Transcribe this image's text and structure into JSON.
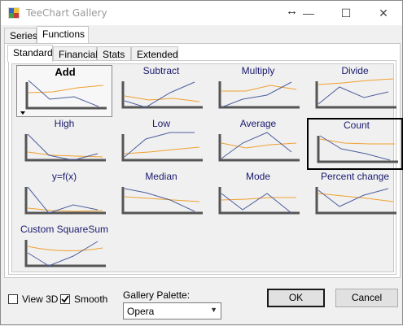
{
  "window": {
    "title": "TeeChart Gallery"
  },
  "titlebar": {
    "move_glyph": "↔",
    "minimize": "—",
    "maximize": "☐",
    "close": "✕"
  },
  "top_tabs": [
    "Series",
    "Functions"
  ],
  "sub_tabs": [
    "Standard",
    "Financial",
    "Stats",
    "Extended"
  ],
  "gallery": {
    "items": [
      {
        "label": "Add"
      },
      {
        "label": "Subtract"
      },
      {
        "label": "Multiply"
      },
      {
        "label": "Divide"
      },
      {
        "label": "High"
      },
      {
        "label": "Low"
      },
      {
        "label": "Average"
      },
      {
        "label": "Count"
      },
      {
        "label": "y=f(x)"
      },
      {
        "label": "Median"
      },
      {
        "label": "Mode"
      },
      {
        "label": "Percent change"
      },
      {
        "label": "Custom SquareSum"
      }
    ],
    "series_colors": {
      "blue": "#4e5f9e",
      "orange": "#f0a030"
    }
  },
  "options": {
    "view3d_label": "View 3D",
    "view3d_checked": false,
    "smooth_label": "Smooth",
    "smooth_checked": true
  },
  "palette": {
    "label": "Gallery Palette:",
    "value": "Opera"
  },
  "buttons": {
    "ok": "OK",
    "cancel": "Cancel"
  }
}
